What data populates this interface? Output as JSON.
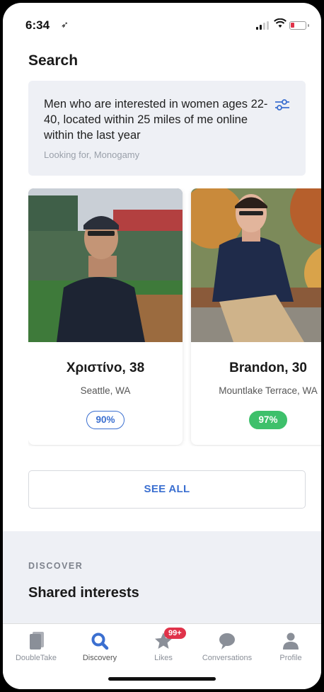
{
  "status_bar": {
    "time": "6:34"
  },
  "header": {
    "title": "Search"
  },
  "filter": {
    "description": "Men who are interested in women ages 22-40, located within 25 miles of me online within the last year",
    "subtext": "Looking for, Monogamy"
  },
  "profiles": [
    {
      "name": "Χριστίνο, 38",
      "location": "Seattle, WA",
      "match": "90%"
    },
    {
      "name": "Brandon, 30",
      "location": "Mountlake Terrace, WA",
      "match": "97%"
    }
  ],
  "see_all_label": "SEE ALL",
  "discover": {
    "label": "DISCOVER",
    "title": "Shared interests"
  },
  "tabs": [
    {
      "label": "DoubleTake",
      "icon": "cards-icon"
    },
    {
      "label": "Discovery",
      "icon": "search-icon"
    },
    {
      "label": "Likes",
      "icon": "star-icon",
      "badge": "99+"
    },
    {
      "label": "Conversations",
      "icon": "chat-bubble-icon"
    },
    {
      "label": "Profile",
      "icon": "person-icon"
    }
  ],
  "colors": {
    "accent": "#3b6fd0",
    "match_green": "#3ec06b",
    "badge_red": "#e0334a",
    "section_bg": "#eef0f5"
  }
}
